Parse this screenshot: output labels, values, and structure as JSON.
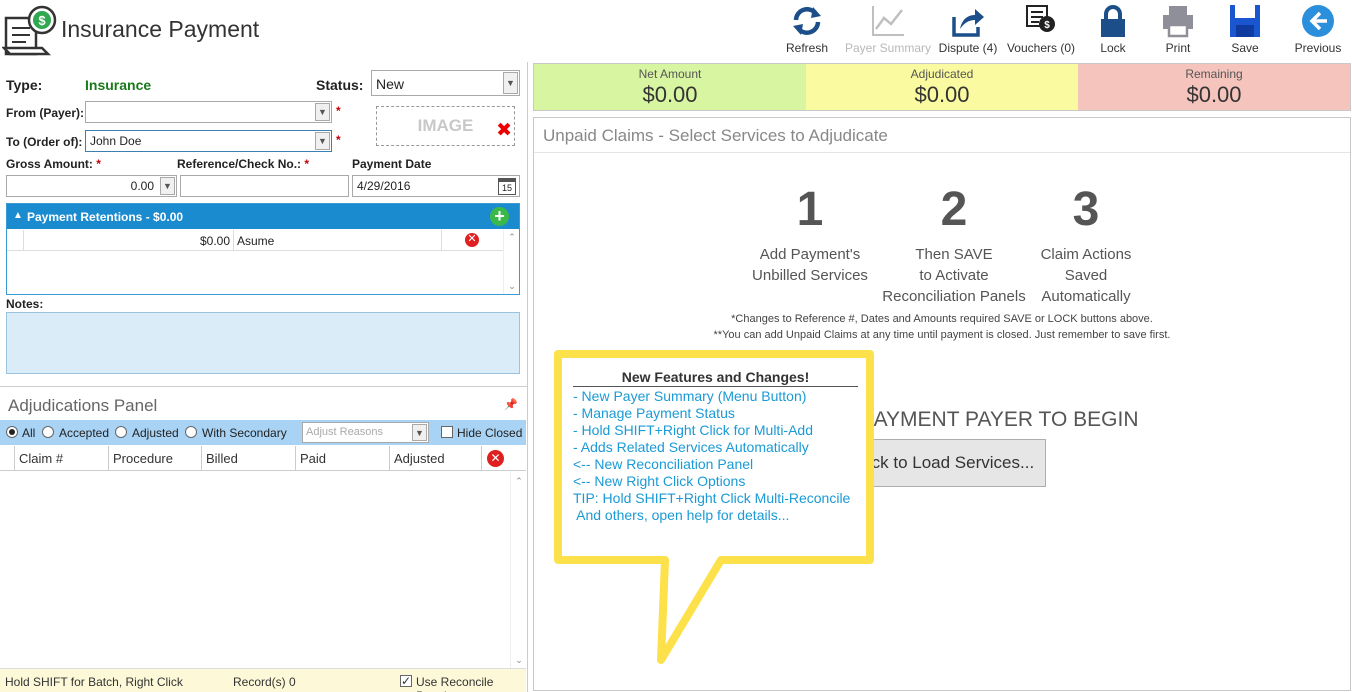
{
  "app": {
    "title": "Insurance Payment"
  },
  "toolbar": [
    {
      "id": "refresh",
      "label": "Refresh",
      "icon": "refresh-icon",
      "enabled": true
    },
    {
      "id": "payer-summary",
      "label": "Payer Summary",
      "icon": "chart-line-icon",
      "enabled": false
    },
    {
      "id": "dispute",
      "label": "Dispute (4)",
      "icon": "share-icon",
      "enabled": true
    },
    {
      "id": "vouchers",
      "label": "Vouchers (0)",
      "icon": "voucher-icon",
      "enabled": true
    },
    {
      "id": "lock",
      "label": "Lock",
      "icon": "lock-icon",
      "enabled": true
    },
    {
      "id": "print",
      "label": "Print",
      "icon": "printer-icon",
      "enabled": true
    },
    {
      "id": "save",
      "label": "Save",
      "icon": "floppy-icon",
      "enabled": true
    },
    {
      "id": "previous",
      "label": "Previous",
      "icon": "arrow-left-icon",
      "enabled": true
    }
  ],
  "form": {
    "type_label": "Type:",
    "type_value": "Insurance",
    "status_label": "Status:",
    "status_value": "New",
    "from_label": "From (Payer):",
    "from_value": "",
    "to_label": "To (Order of):",
    "to_value": "John Doe",
    "image_label": "IMAGE",
    "gross_label": "Gross Amount:",
    "gross_value": "0.00",
    "reference_label": "Reference/Check No.:",
    "reference_value": "",
    "date_label": "Payment Date",
    "date_value": "4/29/2016",
    "calendar_day": "15",
    "required_mark": "*"
  },
  "retentions": {
    "title": "Payment Retentions - $0.00",
    "rows": [
      {
        "amount": "$0.00",
        "name": "Asume"
      }
    ]
  },
  "notes": {
    "label": "Notes:",
    "value": ""
  },
  "adjudications": {
    "title": "Adjudications Panel",
    "filters": [
      {
        "label": "All",
        "selected": true
      },
      {
        "label": "Accepted",
        "selected": false
      },
      {
        "label": "Adjusted",
        "selected": false
      },
      {
        "label": "With Secondary",
        "selected": false
      }
    ],
    "adjust_reasons_placeholder": "Adjust Reasons",
    "hide_closed_label": "Hide Closed",
    "columns": [
      "Claim #",
      "Procedure",
      "Billed",
      "Paid",
      "Adjusted"
    ]
  },
  "status_bar": {
    "hint": "Hold SHIFT for Batch, Right Click",
    "records": "Record(s) 0",
    "reconcile_label": "Use Reconcile Panel",
    "reconcile_checked": true
  },
  "totals": [
    {
      "label": "Net Amount",
      "value": "$0.00",
      "color": "#d8f5a2"
    },
    {
      "label": "Adjudicated",
      "value": "$0.00",
      "color": "#fafaa0"
    },
    {
      "label": "Remaining",
      "value": "$0.00",
      "color": "#f5c4bc"
    }
  ],
  "claims": {
    "title": "Unpaid Claims - Select Services to Adjudicate",
    "steps": [
      {
        "num": "1",
        "lines": [
          "Add Payment's",
          "Unbilled Services"
        ]
      },
      {
        "num": "2",
        "lines": [
          "Then SAVE",
          "to Activate",
          "Reconciliation Panels"
        ]
      },
      {
        "num": "3",
        "lines": [
          "Claim Actions",
          "Saved",
          "Automatically"
        ]
      }
    ],
    "note1": "*Changes to Reference #, Dates and Amounts required SAVE or LOCK buttons above.",
    "note2": "**You can add Unpaid Claims at any time until payment is closed. Just remember to save first.",
    "begin_text": "SELECT PAYMENT PAYER TO BEGIN",
    "load_button": "Click to Load Services..."
  },
  "callout": {
    "heading": "New Features and Changes!",
    "items": [
      "- New Payer Summary (Menu Button)",
      "- Manage Payment Status",
      "- Hold SHIFT+Right Click for Multi-Add",
      "- Adds Related Services Automatically",
      "<-- New Reconciliation Panel",
      "<-- New Right Click Options",
      "TIP: Hold SHIFT+Right Click Multi-Reconcile",
      " And others, open help for details..."
    ],
    "border_color": "#fde14a"
  }
}
